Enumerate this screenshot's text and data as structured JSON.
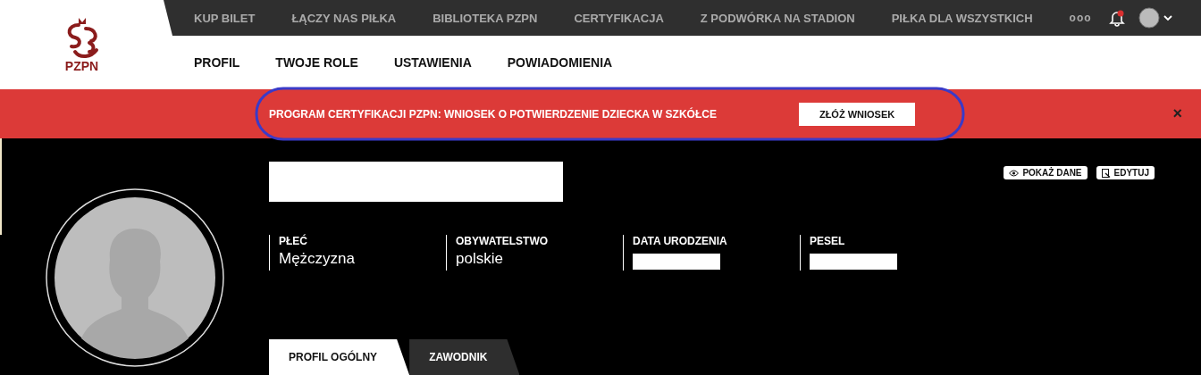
{
  "logo": {
    "text": "PZPN"
  },
  "top_nav": [
    "KUP BILET",
    "ŁĄCZY NAS PIŁKA",
    "BIBLIOTEKA PZPN",
    "CERTYFIKACJA",
    "Z PODWÓRKA NA STADION",
    "PIŁKA DLA WSZYSTKICH"
  ],
  "more": "ooo",
  "profile_nav": [
    "PROFIL",
    "TWOJE ROLE",
    "USTAWIENIA",
    "POWIADOMIENIA"
  ],
  "banner": {
    "message": "PROGRAM CERTYFIKACJI PZPN: WNIOSEK O POTWIERDZENIE DZIECKA W SZKÓŁCE",
    "button": "ZŁÓŻ WNIOSEK",
    "close": "×"
  },
  "actions": [
    "POKAŻ DANE",
    "EDYTUJ"
  ],
  "fields": [
    {
      "label": "PŁEĆ",
      "value": "Mężczyzna",
      "redacted": false
    },
    {
      "label": "OBYWATELSTWO",
      "value": "polskie",
      "redacted": false
    },
    {
      "label": "DATA URODZENIA",
      "redacted": true
    },
    {
      "label": "PESEL",
      "redacted": true
    }
  ],
  "tabs": [
    {
      "label": "PROFIL OGÓLNY",
      "selected": true
    },
    {
      "label": "ZAWODNIK",
      "selected": false
    }
  ]
}
